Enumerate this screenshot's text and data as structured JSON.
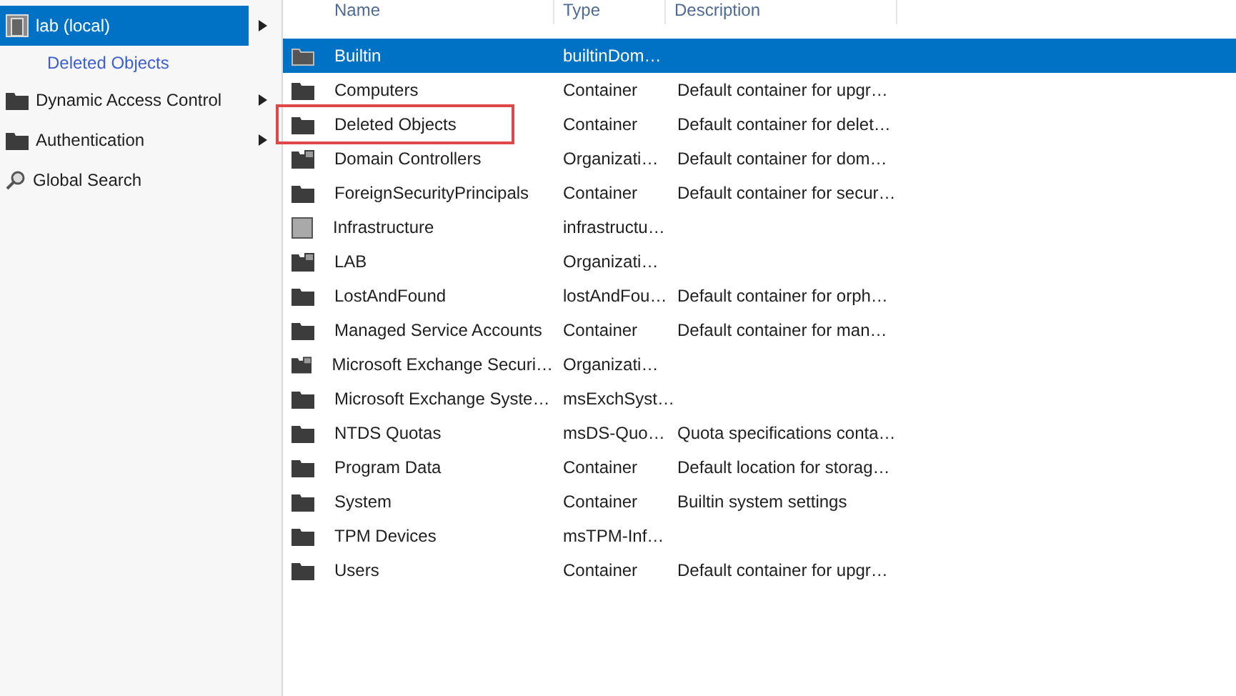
{
  "sidebar": {
    "items": [
      {
        "label": "lab (local)",
        "kind": "domain",
        "selected": true,
        "has_submenu": true,
        "children": [
          {
            "label": "Deleted Objects",
            "selected": false,
            "has_submenu": false
          }
        ]
      },
      {
        "label": "Dynamic Access Control",
        "kind": "folder",
        "selected": false,
        "has_submenu": true
      },
      {
        "label": "Authentication",
        "kind": "folder",
        "selected": false,
        "has_submenu": true
      },
      {
        "label": "Global Search",
        "kind": "search",
        "selected": false,
        "has_submenu": false
      }
    ]
  },
  "table": {
    "columns": [
      "Name",
      "Type",
      "Description"
    ],
    "rows": [
      {
        "kind": "builtin",
        "cells": [
          "Builtin",
          "builtinDom…",
          ""
        ],
        "selected": true,
        "highlighted": false
      },
      {
        "kind": "folder",
        "cells": [
          "Computers",
          "Container",
          "Default container for upgr…"
        ],
        "selected": false,
        "highlighted": false
      },
      {
        "kind": "folder",
        "cells": [
          "Deleted Objects",
          "Container",
          "Default container for delet…"
        ],
        "selected": false,
        "highlighted": true
      },
      {
        "kind": "ou",
        "cells": [
          "Domain Controllers",
          "Organizati…",
          "Default container for dom…"
        ],
        "selected": false,
        "highlighted": false
      },
      {
        "kind": "folder",
        "cells": [
          "ForeignSecurityPrincipals",
          "Container",
          "Default container for secur…"
        ],
        "selected": false,
        "highlighted": false
      },
      {
        "kind": "infra",
        "cells": [
          "Infrastructure",
          "infrastructu…",
          ""
        ],
        "selected": false,
        "highlighted": false
      },
      {
        "kind": "ou",
        "cells": [
          "LAB",
          "Organizati…",
          ""
        ],
        "selected": false,
        "highlighted": false
      },
      {
        "kind": "folder",
        "cells": [
          "LostAndFound",
          "lostAndFou…",
          "Default container for orph…"
        ],
        "selected": false,
        "highlighted": false
      },
      {
        "kind": "folder",
        "cells": [
          "Managed Service Accounts",
          "Container",
          "Default container for man…"
        ],
        "selected": false,
        "highlighted": false
      },
      {
        "kind": "ou",
        "cells": [
          "Microsoft Exchange Securi…",
          "Organizati…",
          ""
        ],
        "selected": false,
        "highlighted": false
      },
      {
        "kind": "folder",
        "cells": [
          "Microsoft Exchange Syste…",
          "msExchSyst…",
          ""
        ],
        "selected": false,
        "highlighted": false
      },
      {
        "kind": "folder",
        "cells": [
          "NTDS Quotas",
          "msDS-Quo…",
          "Quota specifications conta…"
        ],
        "selected": false,
        "highlighted": false
      },
      {
        "kind": "folder",
        "cells": [
          "Program Data",
          "Container",
          "Default location for storag…"
        ],
        "selected": false,
        "highlighted": false
      },
      {
        "kind": "folder",
        "cells": [
          "System",
          "Container",
          "Builtin system settings"
        ],
        "selected": false,
        "highlighted": false
      },
      {
        "kind": "folder",
        "cells": [
          "TPM Devices",
          "msTPM-Inf…",
          ""
        ],
        "selected": false,
        "highlighted": false
      },
      {
        "kind": "folder",
        "cells": [
          "Users",
          "Container",
          "Default container for upgr…"
        ],
        "selected": false,
        "highlighted": false
      }
    ]
  }
}
